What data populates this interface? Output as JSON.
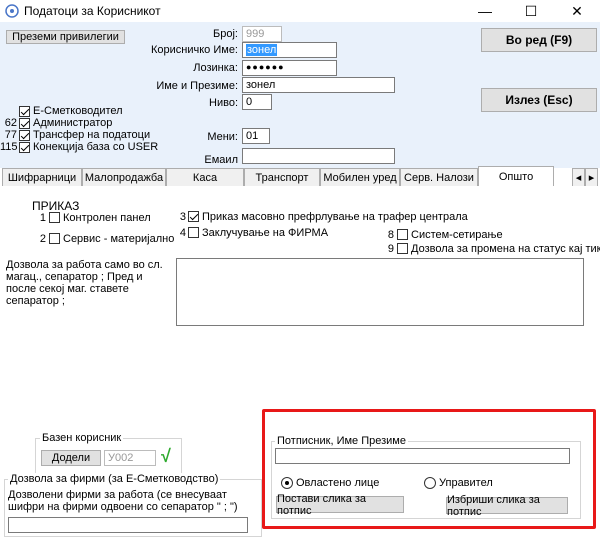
{
  "window": {
    "title": "Податоци за Корисникот",
    "controls": {
      "minimize": "—",
      "maximize": "☐",
      "close": "✕"
    }
  },
  "header": {
    "privileges_button": "Преземи привилегии",
    "ok_button": "Во ред (F9)",
    "exit_button": "Излез (Esc)",
    "number": {
      "label": "Број:",
      "value": "999"
    },
    "username": {
      "label": "Корисничко Име:",
      "value": "зонел"
    },
    "password": {
      "label": "Лозинка:",
      "value": "●●●●●●"
    },
    "fullname": {
      "label": "Име и Презиме:",
      "value": "зонел"
    },
    "level": {
      "label": "Ниво:",
      "value": "0"
    },
    "menu": {
      "label": "Мени:",
      "value": "01"
    },
    "email": {
      "label": "Емаил",
      "value": ""
    }
  },
  "flags": [
    {
      "num": "",
      "label": "Е-Сметководител",
      "checked": true
    },
    {
      "num": "62",
      "label": "Администратор",
      "checked": true
    },
    {
      "num": "77",
      "label": "Трансфер на податоци",
      "checked": true
    },
    {
      "num": "115",
      "label": "Конекција база со USER",
      "checked": true
    }
  ],
  "tabs": [
    {
      "label": "Шифрарници"
    },
    {
      "label": "Малопродажба"
    },
    {
      "label": "Каса"
    },
    {
      "label": "Транспорт"
    },
    {
      "label": "Мобилен уред"
    },
    {
      "label": "Серв. Налози"
    },
    {
      "label": "Општо",
      "active": true
    }
  ],
  "tab_scroll": {
    "left": "◂",
    "right": "▸"
  },
  "general": {
    "section_title": "ПРИКАЗ",
    "options": [
      {
        "num": "1",
        "label": "Контролен панел",
        "checked": false
      },
      {
        "num": "2",
        "label": "Сервис - материјално",
        "checked": false
      },
      {
        "num": "3",
        "label": "Приказ масовно префрлување на трафер централа",
        "checked": true
      },
      {
        "num": "4",
        "label": "Заклучување на ФИРМА",
        "checked": false
      },
      {
        "num": "8",
        "label": "Систем-сетирање",
        "checked": false
      },
      {
        "num": "9",
        "label": "Дозвола за промена на статус кај тикет",
        "checked": false
      }
    ],
    "warehouse_note": "Дозвола за работа само во сл. магац., сепаратор  ; Пред и после секој маг. ставете сепаратор ;",
    "warehouse_value": ""
  },
  "base_user": {
    "title": "Базен корисник",
    "assign_button": "Додели",
    "value": "У002",
    "check_glyph": "√"
  },
  "company_permission": {
    "title": "Дозвола за фирми (за Е-Сметководство)",
    "note": "Дозволени фирми за работа (се внесуваат шифри на фирми одвоени со сепаратор \" ; \")",
    "value": ""
  },
  "signature": {
    "title": "Потписник, Име Презиме",
    "value": "",
    "radio_authorized": "Овластено лице",
    "radio_manager": "Управител",
    "set_image_button": "Постави слика за потпис",
    "delete_image_button": "Избриши слика за потпис"
  },
  "colors": {
    "highlight": "#e81818",
    "top_bg": "#e9f1fb",
    "check_green": "#2eaa2e"
  }
}
